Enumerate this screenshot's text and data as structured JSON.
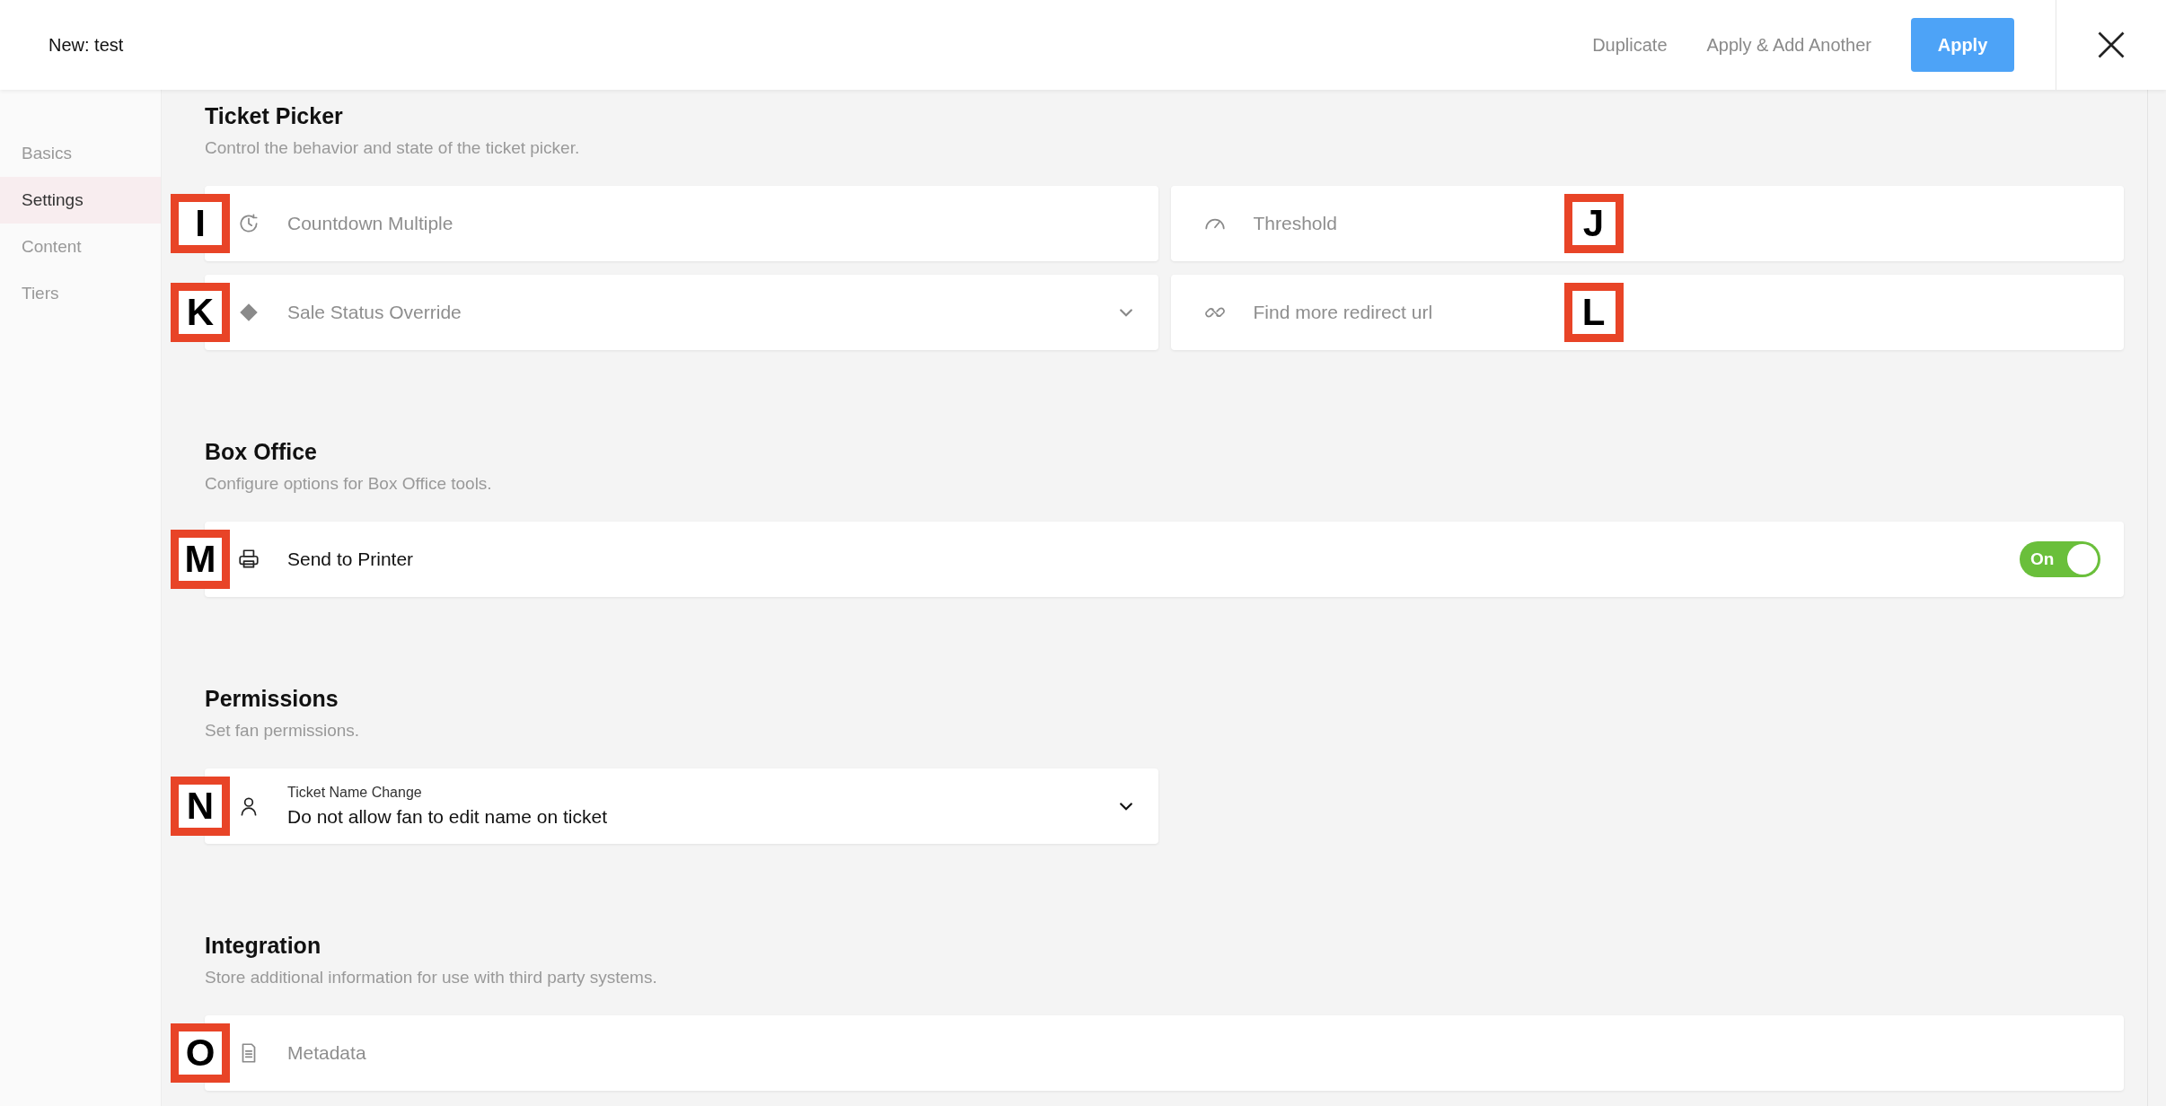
{
  "header": {
    "title": "New: test",
    "actions": [
      {
        "label": "Duplicate",
        "kind": "link"
      },
      {
        "label": "Apply & Add Another",
        "kind": "link"
      },
      {
        "label": "Apply",
        "kind": "primary"
      }
    ]
  },
  "sidebar": {
    "items": [
      {
        "label": "Basics",
        "selected": false
      },
      {
        "label": "Settings",
        "selected": true
      },
      {
        "label": "Content",
        "selected": false
      },
      {
        "label": "Tiers",
        "selected": false
      }
    ]
  },
  "sections": [
    {
      "title": "Ticket Picker",
      "description": "Control the behavior and state of the ticket picker.",
      "rows": [
        [
          {
            "kind": "input",
            "placeholder": "Countdown Multiple",
            "marker": "I"
          },
          {
            "kind": "input",
            "placeholder": "Threshold",
            "marker": "J"
          }
        ],
        [
          {
            "kind": "select",
            "placeholder": "Sale Status Override",
            "marker": "K"
          },
          {
            "kind": "input",
            "placeholder": "Find more redirect url",
            "marker": "L"
          }
        ]
      ]
    },
    {
      "title": "Box Office",
      "description": "Configure options for Box Office tools.",
      "rows": [
        [
          {
            "kind": "toggle",
            "label": "Send to Printer",
            "toggle_label": "On",
            "on": true,
            "marker": "M"
          }
        ]
      ]
    },
    {
      "title": "Permissions",
      "description": "Set fan permissions.",
      "rows": [
        [
          {
            "kind": "select_value",
            "label": "Ticket Name Change",
            "value": "Do not allow fan to edit name on ticket",
            "marker": "N"
          },
          {
            "kind": "empty"
          }
        ]
      ]
    },
    {
      "title": "Integration",
      "description": "Store additional information for use with third party systems.",
      "rows": [
        [
          {
            "kind": "input",
            "placeholder": "Metadata",
            "marker": "O"
          }
        ]
      ]
    }
  ]
}
